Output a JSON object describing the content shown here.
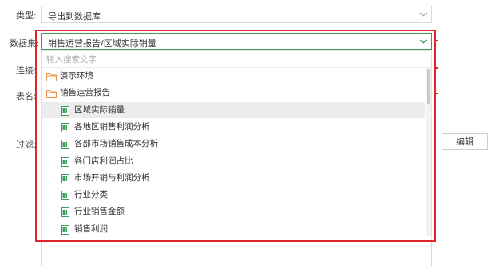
{
  "form": {
    "type_label": "类型:",
    "type_value": "导出到数据库",
    "dataset_label": "数据集:",
    "dataset_value": "销售运营报告/区域实际销量",
    "connect_label": "连接:",
    "table_label": "表名:",
    "filter_label": "过滤:",
    "edit_button": "编辑"
  },
  "dropdown": {
    "search_placeholder": "输入搜索文字",
    "items": [
      {
        "label": "演示环境",
        "type": "folder",
        "selected": false
      },
      {
        "label": "销售运营报告",
        "type": "folder",
        "selected": false
      },
      {
        "label": "区域实际销量",
        "type": "dataset",
        "selected": true
      },
      {
        "label": "各地区销售利润分析",
        "type": "dataset",
        "selected": false
      },
      {
        "label": "各部市场销售成本分析",
        "type": "dataset",
        "selected": false
      },
      {
        "label": "各门店利润占比",
        "type": "dataset",
        "selected": false
      },
      {
        "label": "市场开销与利润分析",
        "type": "dataset",
        "selected": false
      },
      {
        "label": "行业分类",
        "type": "dataset",
        "selected": false
      },
      {
        "label": "行业销售金额",
        "type": "dataset",
        "selected": false
      },
      {
        "label": "销售利润",
        "type": "dataset",
        "selected": false
      }
    ]
  },
  "colors": {
    "highlight_border": "#e0262a",
    "active_input_border": "#3f9a5c",
    "folder_icon": "#e8954a",
    "dataset_icon": "#3aa05a",
    "selected_row": "#ececec"
  }
}
